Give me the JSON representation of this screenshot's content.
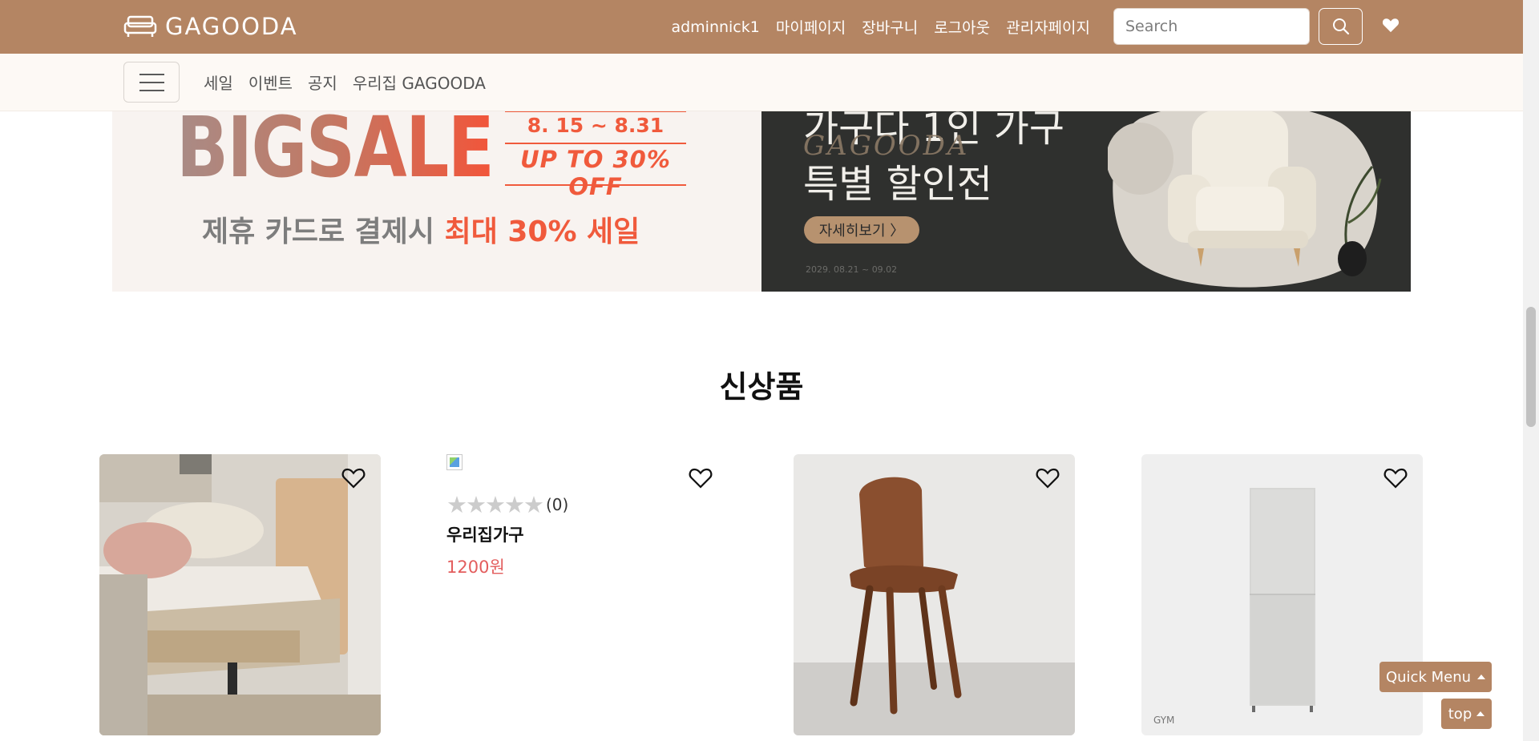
{
  "header": {
    "brand": "GAGOODA",
    "user_links": [
      "adminnick1",
      "마이페이지",
      "장바구니",
      "로그아웃",
      "관리자페이지"
    ],
    "search_placeholder": "Search"
  },
  "subnav": {
    "items": [
      "세일",
      "이벤트",
      "공지",
      "우리집 GAGOODA"
    ]
  },
  "banner_left": {
    "headline": "BIGSALE",
    "dates": "8. 15 ~ 8.31",
    "discount": "UP TO 30% OFF",
    "card_text": "제휴 카드로 결제시",
    "card_highlight": "최대 30% 세일"
  },
  "banner_right": {
    "title_line1": "가구다 1인 가구",
    "script": "GAGOODA",
    "title_line2": "특별 할인전",
    "button": "자세히보기 〉",
    "date": "2029. 08.21 ~ 09.02"
  },
  "section": {
    "title": "신상품"
  },
  "products": [
    {
      "image": "bed-photo"
    },
    {
      "image": "broken-image",
      "stars": "★★★★★",
      "review_count": "(0)",
      "name": "우리집가구",
      "price": "1200원"
    },
    {
      "image": "chair-photo"
    },
    {
      "image": "cabinet-photo",
      "watermark": "GYM"
    }
  ],
  "floating": {
    "quick_menu": "Quick Menu",
    "top": "top"
  },
  "colors": {
    "brand": "#b48563",
    "subnav_bg": "#fdf9f5",
    "price": "#e35d5d",
    "sale_accent": "#f05a3c"
  }
}
